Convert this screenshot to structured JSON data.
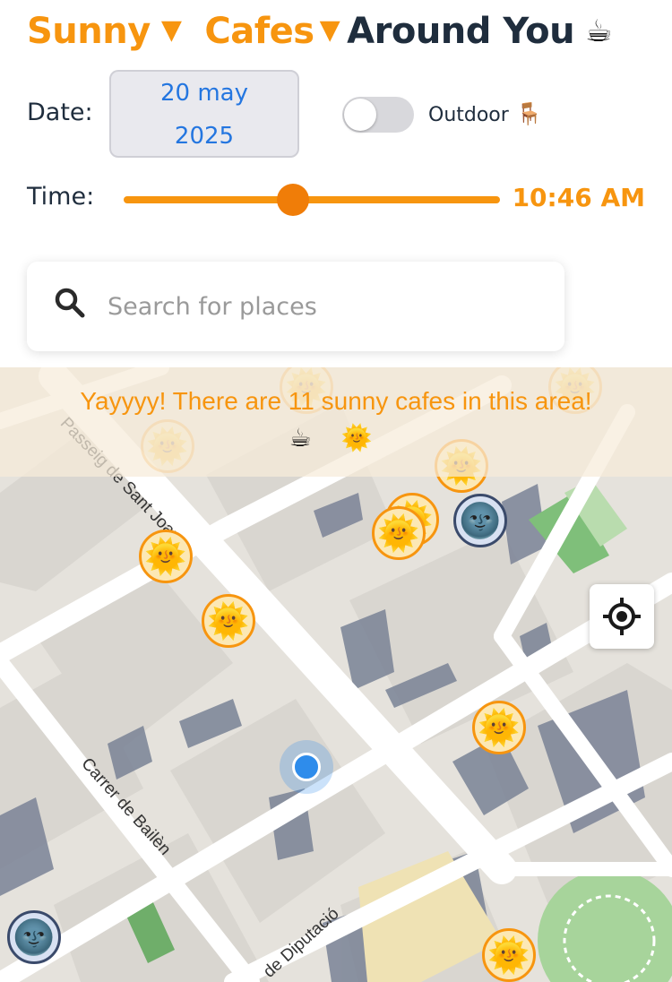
{
  "header": {
    "title_word1": "Sunny",
    "title_arrow": "▼",
    "title_word2": "Cafes",
    "title_word3": "Around You",
    "title_icon": "☕"
  },
  "date": {
    "label": "Date:",
    "value_line1": "20 may",
    "value_line2": "2025"
  },
  "outdoor_toggle": {
    "label": "Outdoor",
    "icon": "🪑",
    "enabled": false
  },
  "time": {
    "label": "Time:",
    "value": "10:46 AM",
    "slider_fraction": 0.45
  },
  "search": {
    "placeholder": "Search for places"
  },
  "map": {
    "banner_text": "Yayyyy! There are 11 sunny cafes in this area!",
    "banner_emoji": "☕ 🌞",
    "sun_icon": "🌞",
    "moon_icon": "🌚",
    "streets": [
      "Passeig de Sant Joan",
      "Carrer de Bailèn",
      "de Diputació"
    ]
  },
  "colors": {
    "accent": "#f7950f",
    "title_dark": "#1f2d3d",
    "date_text": "#2476e0",
    "user_location": "#2e8ceb"
  }
}
